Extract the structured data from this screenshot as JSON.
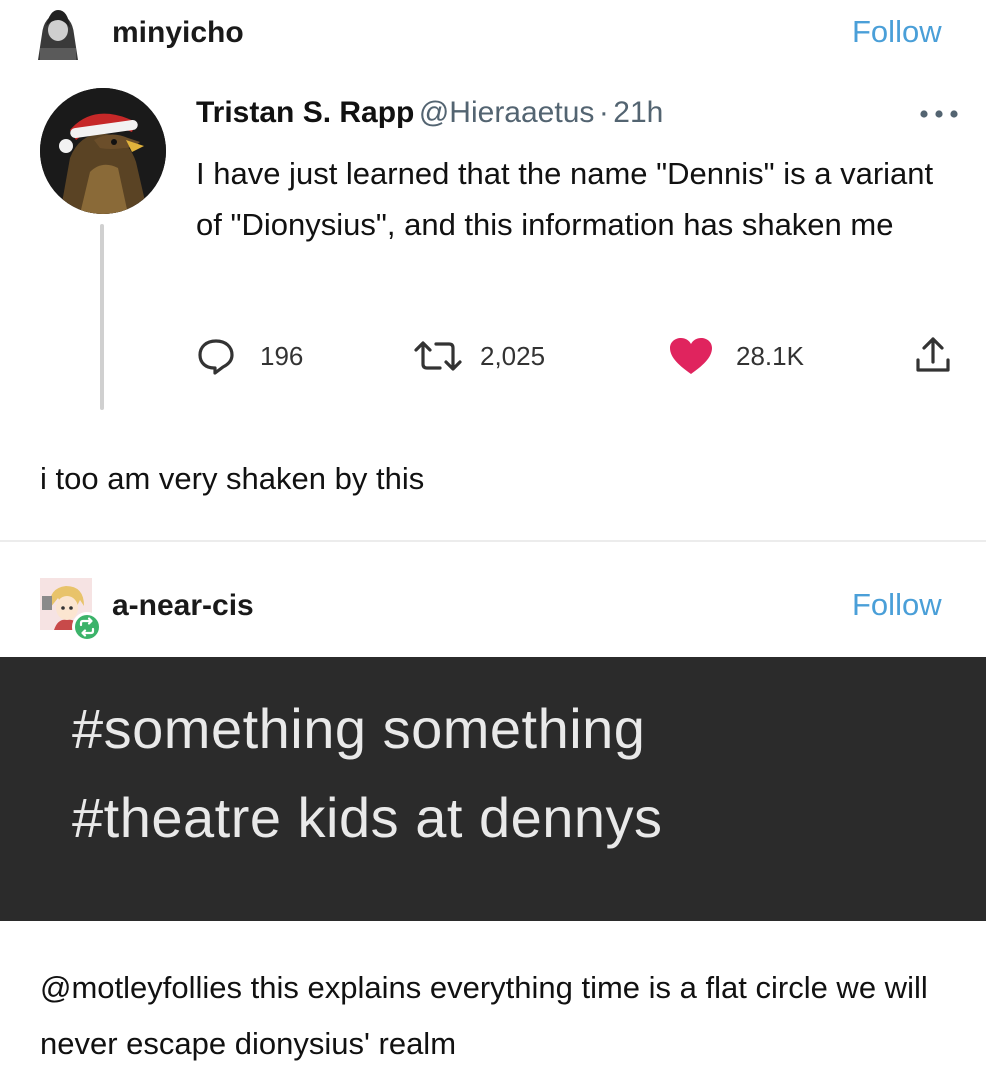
{
  "post1": {
    "username": "minyicho",
    "follow_label": "Follow",
    "avatar_icon": "user-avatar-icon"
  },
  "tweet": {
    "author": "Tristan S. Rapp",
    "handle": "@Hieraaetus",
    "separator": "·",
    "time": "21h",
    "more_icon": "more-dots-icon",
    "text": "I have just learned that the name \"Dennis\" is a variant of \"Dionysius\", and this information has shaken me",
    "metrics": {
      "replies": "196",
      "retweets": "2,025",
      "likes": "28.1K"
    },
    "icons": {
      "reply": "reply-icon",
      "retweet": "retweet-icon",
      "like": "heart-icon",
      "share": "share-icon"
    },
    "colors": {
      "like": "#e0245e",
      "handle": "#536471"
    }
  },
  "post1_comment": "i too am very shaken by this",
  "post2": {
    "username": "a-near-cis",
    "follow_label": "Follow",
    "reblog_icon": "reblog-icon",
    "tags": [
      "#something something",
      "#theatre kids at dennys"
    ]
  },
  "post2_comment": {
    "mention": "@motleyfollies",
    "text": " this explains everything time is a flat circle we will never escape dionysius' realm"
  },
  "colors": {
    "follow": "#4a9fd8",
    "dark_panel": "#2b2b2b",
    "reblog_badge": "#3cb36a"
  }
}
